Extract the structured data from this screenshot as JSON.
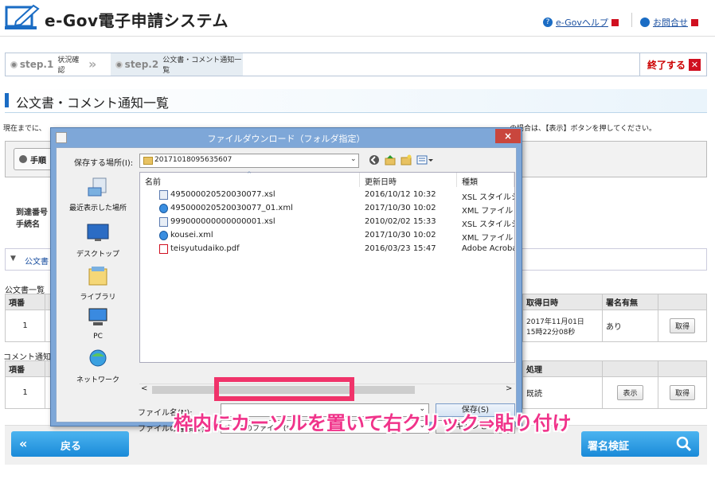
{
  "header": {
    "title": "e-Gov電子申請システム",
    "help_link": "e-Govヘルプ",
    "contact_link": "お問合せ"
  },
  "steps": {
    "step1_num": "step.1",
    "step1_label": "状況確認",
    "step2_num": "step.2",
    "step2_label": "公文書・コメント通知一覧",
    "end_label": "終了する"
  },
  "page": {
    "title": "公文書・コメント通知一覧",
    "intro": "現在までに、",
    "intro_tail": "の場合は、【表示】ボタンを押してください。"
  },
  "background": {
    "proc_button": "手順",
    "arrival_label": "到達番号",
    "proc_name_label": "手続名",
    "accordion_label": "公文書",
    "official_section": "公文書一覧",
    "comment_section": "コメント通知一",
    "official_table": {
      "col_no": "項番",
      "col_date": "取得日時",
      "col_sign": "署名有無",
      "row_no": "1",
      "row_date_line1": "2017年11月01日",
      "row_date_line2": "15時22分08秒",
      "row_sign": "あり",
      "row_btn": "取得"
    },
    "comment_table": {
      "col_no": "項番",
      "col_proc": "処理",
      "row_no": "1",
      "row_status": "既読",
      "row_show_btn": "表示",
      "row_get_btn": "取得"
    }
  },
  "footer": {
    "back": "戻る",
    "verify": "署名検証"
  },
  "dialog": {
    "title": "ファイルダウンロード（フォルダ指定）",
    "close": "×",
    "save_in_label": "保存する場所(I):",
    "save_in_value": "20171018095635607",
    "places": [
      "最近表示した場所",
      "デスクトップ",
      "ライブラリ",
      "PC",
      "ネットワーク"
    ],
    "columns": {
      "name": "名前",
      "date": "更新日時",
      "type": "種類"
    },
    "files": [
      {
        "name": "495000020520030077.xsl",
        "date": "2016/10/12 10:32",
        "type": "XSL スタイルシー",
        "icon": "xsl"
      },
      {
        "name": "495000020520030077_01.xml",
        "date": "2017/10/30 10:02",
        "type": "XML ファイル",
        "icon": "xml"
      },
      {
        "name": "999000000000000001.xsl",
        "date": "2010/02/02 15:33",
        "type": "XSL スタイルシー",
        "icon": "xsl"
      },
      {
        "name": "kousei.xml",
        "date": "2017/10/30 10:02",
        "type": "XML ファイル",
        "icon": "xml"
      },
      {
        "name": "teisyutudaiko.pdf",
        "date": "2016/03/23 15:47",
        "type": "Adobe Acroba",
        "icon": "pdf"
      }
    ],
    "filename_label": "ファイル名(N):",
    "filename_value": "",
    "filetype_label": "ファイルの種類(T):",
    "filetype_value": "すべてのファイル (*.*)",
    "save_btn": "保存(S)",
    "cancel_btn": "キャンセル"
  },
  "annotation": {
    "text": "枠内にカーソルを置いて右クリック⇒貼り付け"
  },
  "colors": {
    "accent": "#1a8ad8",
    "annotation": "#f0338a",
    "dialog_frame": "#7ea7d8",
    "close": "#c9463d"
  }
}
